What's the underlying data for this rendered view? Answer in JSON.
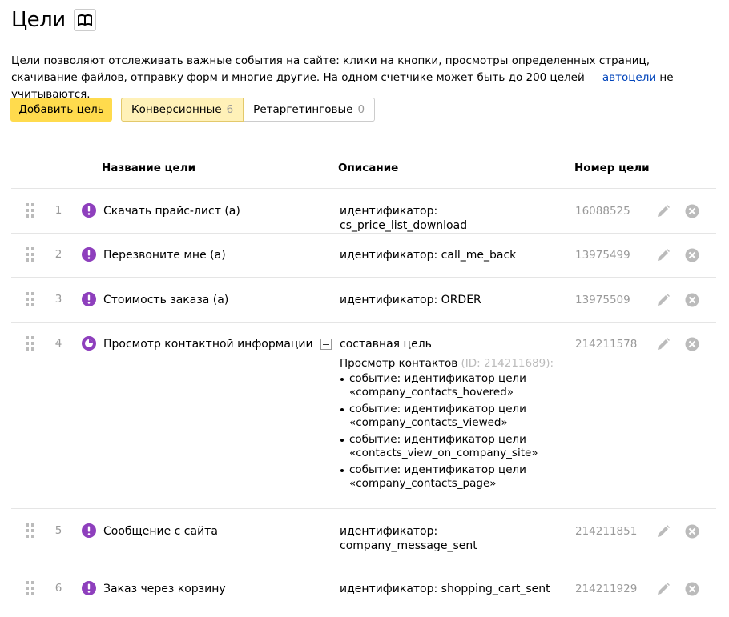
{
  "page": {
    "title": "Цели",
    "intro_before": "Цели позволяют отслеживать важные события на сайте: клики на кнопки, просмотры определенных страниц, скачивание файлов, отправку форм и многие другие. На одном счетчике может быть до 200 целей — ",
    "intro_link": "автоцели",
    "intro_after": " не учитываются."
  },
  "toolbar": {
    "add_label": "Добавить цель",
    "tabs": [
      {
        "label": "Конверсионные",
        "count": "6",
        "active": true
      },
      {
        "label": "Ретаргетинговые",
        "count": "0",
        "active": false
      }
    ]
  },
  "table": {
    "headers": {
      "name": "Название цели",
      "description": "Описание",
      "id": "Номер цели"
    },
    "rows": [
      {
        "num": "1",
        "name": "Скачать прайс-лист (а)",
        "description": "идентификатор: cs_price_list_download",
        "id": "16088525",
        "icon": "exclamation-icon"
      },
      {
        "num": "2",
        "name": "Перезвоните мне (а)",
        "description": "идентификатор: call_me_back",
        "id": "13975499",
        "icon": "exclamation-icon"
      },
      {
        "num": "3",
        "name": "Стоимость заказа (а)",
        "description": "идентификатор: ORDER",
        "id": "13975509",
        "icon": "exclamation-icon"
      },
      {
        "num": "4",
        "name": "Просмотр контактной информации",
        "description": "составная цель",
        "id": "214211578",
        "icon": "composite-goal-icon",
        "step_title": "Просмотр контактов",
        "step_id": "(ID: 214211689):",
        "events": [
          {
            "line1": "событие: идентификатор цели",
            "line2": "«company_contacts_hovered»"
          },
          {
            "line1": "событие: идентификатор цели",
            "line2": "«company_contacts_viewed»"
          },
          {
            "line1": "событие: идентификатор цели",
            "line2": "«contacts_view_on_company_site»"
          },
          {
            "line1": "событие: идентификатор цели",
            "line2": "«company_contacts_page»"
          }
        ]
      },
      {
        "num": "5",
        "name": "Сообщение с сайта",
        "description_line1": "идентификатор:",
        "description_line2": "company_message_sent",
        "id": "214211851",
        "icon": "exclamation-icon"
      },
      {
        "num": "6",
        "name": "Заказ через корзину",
        "description": "идентификатор: shopping_cart_sent",
        "id": "214211929",
        "icon": "exclamation-icon"
      }
    ]
  },
  "colors": {
    "accent": "#ffdb4d",
    "icon": "#8e3fbd",
    "link": "#0044bb"
  }
}
